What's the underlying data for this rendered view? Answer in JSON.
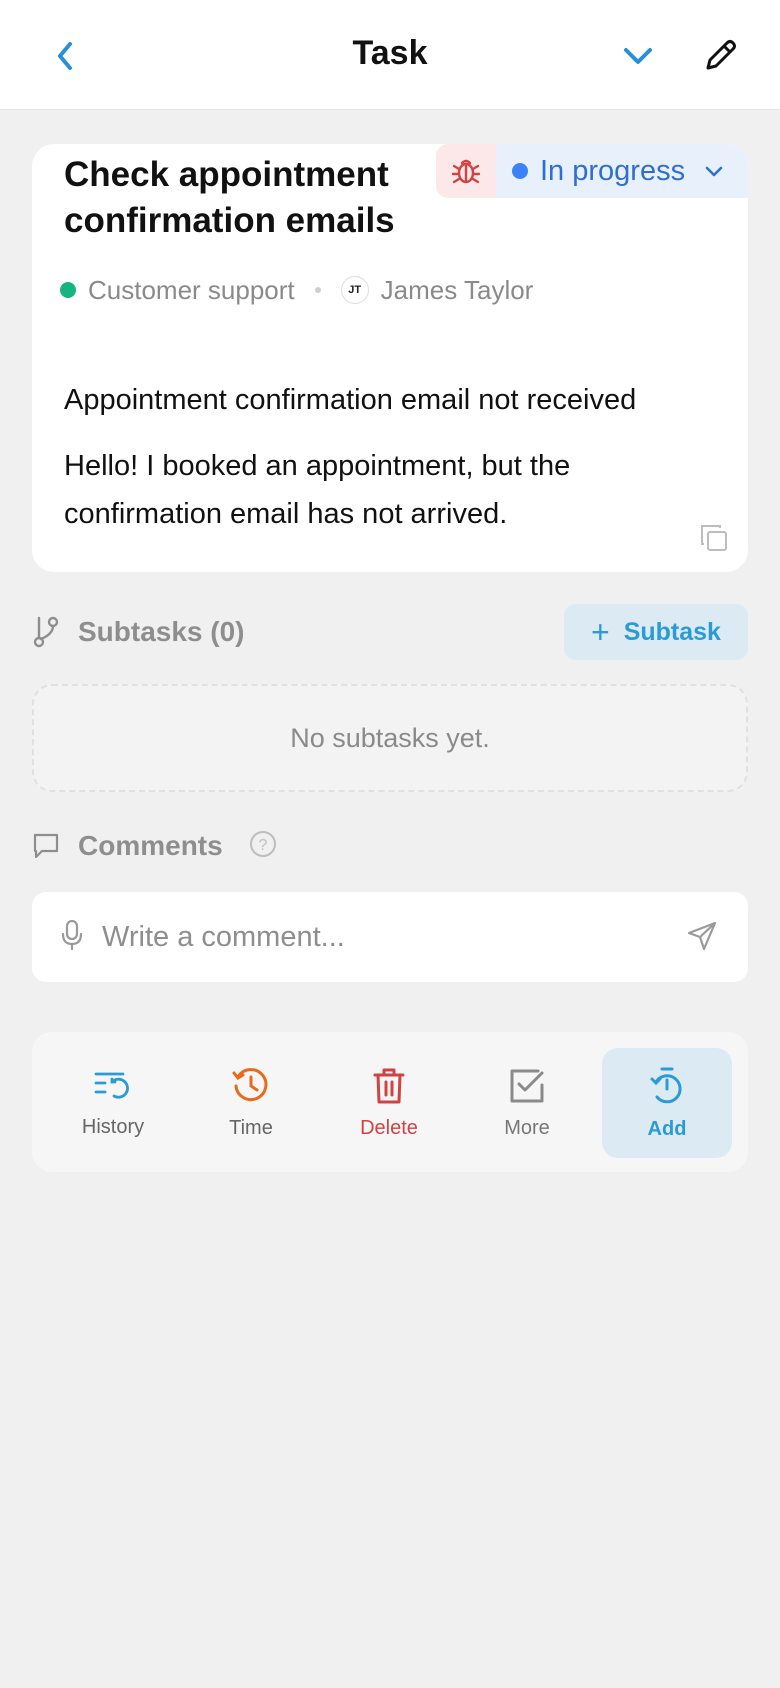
{
  "header": {
    "title": "Task"
  },
  "task": {
    "title": "Check appointment confirmation emails",
    "status": "In progress",
    "team": "Customer support",
    "assignee_initials": "JT",
    "assignee": "James Taylor",
    "subject": "Appointment confirmation email not received",
    "body": "Hello! I booked an appointment, but the confirmation email has not arrived."
  },
  "subtasks": {
    "label": "Subtasks (0)",
    "add_label": "Subtask",
    "empty_text": "No subtasks yet."
  },
  "comments": {
    "label": "Comments",
    "placeholder": "Write a comment..."
  },
  "toolbar": {
    "history": "History",
    "time": "Time",
    "delete": "Delete",
    "more": "More",
    "add": "Add"
  },
  "colors": {
    "accent": "#2b9bd8",
    "status_blue": "#3b82f6",
    "danger": "#d14343",
    "time_orange": "#ea6a1c",
    "team_green": "#16b57f"
  }
}
